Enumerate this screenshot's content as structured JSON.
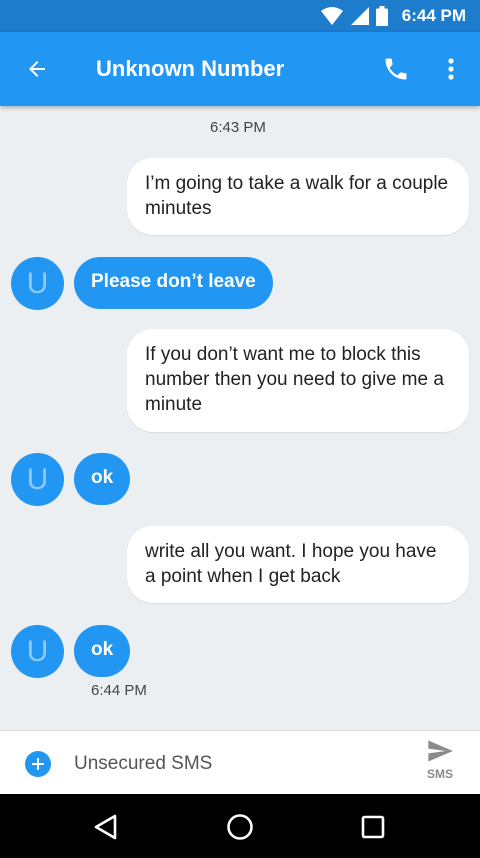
{
  "status_bar": {
    "time": "6:44 PM",
    "icons": [
      "wifi-icon",
      "signal-icon",
      "battery-icon"
    ]
  },
  "header": {
    "title": "Unknown Number",
    "icons": [
      "back-arrow-icon",
      "phone-icon",
      "more-vert-icon"
    ]
  },
  "conversation": {
    "timestamp_top": "6:43 PM",
    "timestamp_bottom": "6:44 PM",
    "avatar_letter": "U",
    "messages": [
      {
        "direction": "outgoing",
        "text": "I’m going to take a walk for a couple minutes"
      },
      {
        "direction": "incoming",
        "text": "Please don’t leave"
      },
      {
        "direction": "outgoing",
        "text": "If you don’t want me to block this number then you need to give me a minute"
      },
      {
        "direction": "incoming",
        "text": "ok"
      },
      {
        "direction": "outgoing",
        "text": "write all you want. I hope you have a point when I get back"
      },
      {
        "direction": "incoming",
        "text": "ok"
      }
    ]
  },
  "compose": {
    "placeholder": "Unsecured SMS",
    "send_label": "SMS"
  },
  "nav_bar": {
    "buttons": [
      "back-triangle-icon",
      "home-circle-icon",
      "recents-square-icon"
    ]
  },
  "colors": {
    "status_bar": "#1e7ccc",
    "app_bar": "#2196f3",
    "background": "#eceff1",
    "incoming_bubble": "#2196f3",
    "outgoing_bubble": "#ffffff",
    "avatar_letter": "#90caf9"
  }
}
